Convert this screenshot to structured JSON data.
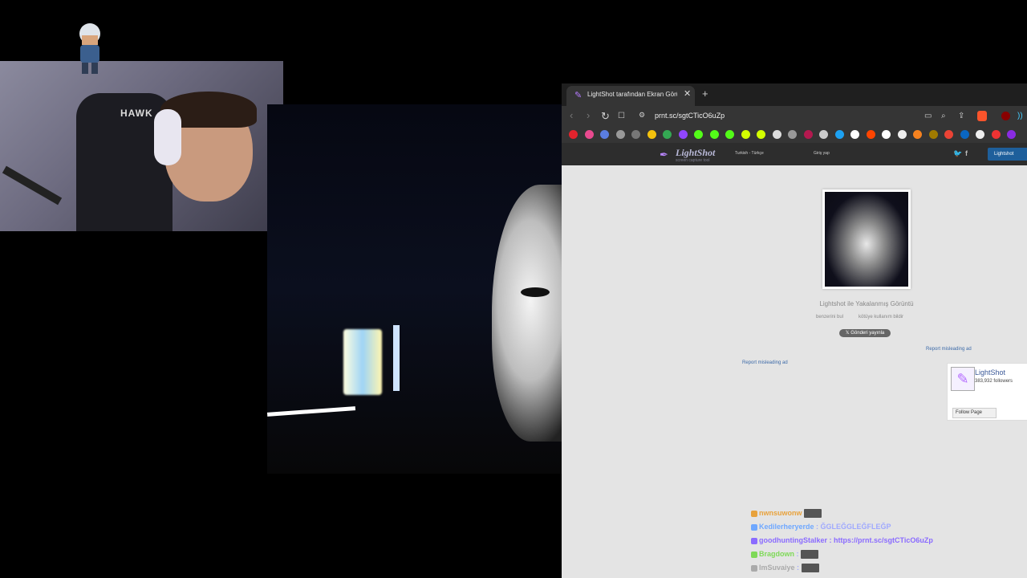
{
  "webcam": {
    "chair_logo": "HAWK"
  },
  "browser": {
    "tab": {
      "title": "LightShot tarafından Ekran Görüntüsü",
      "close": "✕"
    },
    "newtab": "+",
    "toolbar": {
      "back": "‹",
      "forward": "›",
      "reload": "↻",
      "bookmark": "☐",
      "url": "prnt.sc/sgtCTicO6uZp"
    },
    "bookmarks": [
      "#e2232d",
      "#e94a8f",
      "#5a7de0",
      "#999",
      "#777",
      "#f4c20d",
      "#34a853",
      "#9146ff",
      "#53fc18",
      "#53fc18",
      "#53fc18",
      "#d3ff00",
      "#d3ff00",
      "#ddd",
      "#999",
      "#b3194f",
      "#ccc",
      "#1da1f2",
      "#fff",
      "#ff4500",
      "#fff",
      "#eee",
      "#f6821f",
      "#9f7a00",
      "#ea4335",
      "#0a66c2",
      "#eee",
      "#e33",
      "#8a2be2"
    ],
    "lightshot": {
      "logo": "LightShot",
      "subtitle": "screen capture tool",
      "language": "Turkish - Türkçe",
      "login": "Giriş yap",
      "twitter": "🐦",
      "facebook": "f",
      "download": "Lightshot"
    },
    "content": {
      "shot_title": "Lightshot ile Yakalanmış Görüntü",
      "similar": "benzerini bul",
      "report": "kötüye kullanım bildir",
      "tweet": "𝕏 Gönderi yayınla",
      "report_ad_1": "Report misleading ad",
      "report_ad_2": "Report misleading ad"
    },
    "fb_widget": {
      "name": "LightShot",
      "followers": "383,932 followers",
      "follow": "Follow Page"
    }
  },
  "chat": [
    {
      "user": "nwnsuwonw",
      "color": "#e8a23c",
      "message": ""
    },
    {
      "user": "Kedilerheryerde",
      "color": "#6fa8ff",
      "message": ": ĞGLEĞGLEĞFLEĞP"
    },
    {
      "user": "goodhuntingStalker",
      "color": "#8a6bff",
      "message": ": https://prnt.sc/sgtCTicO6uZp"
    },
    {
      "user": "Bragdown",
      "color": "#7ed957",
      "message": ":"
    },
    {
      "user": "ImSuvaiye",
      "color": "#aaaaaa",
      "message": ":"
    }
  ]
}
